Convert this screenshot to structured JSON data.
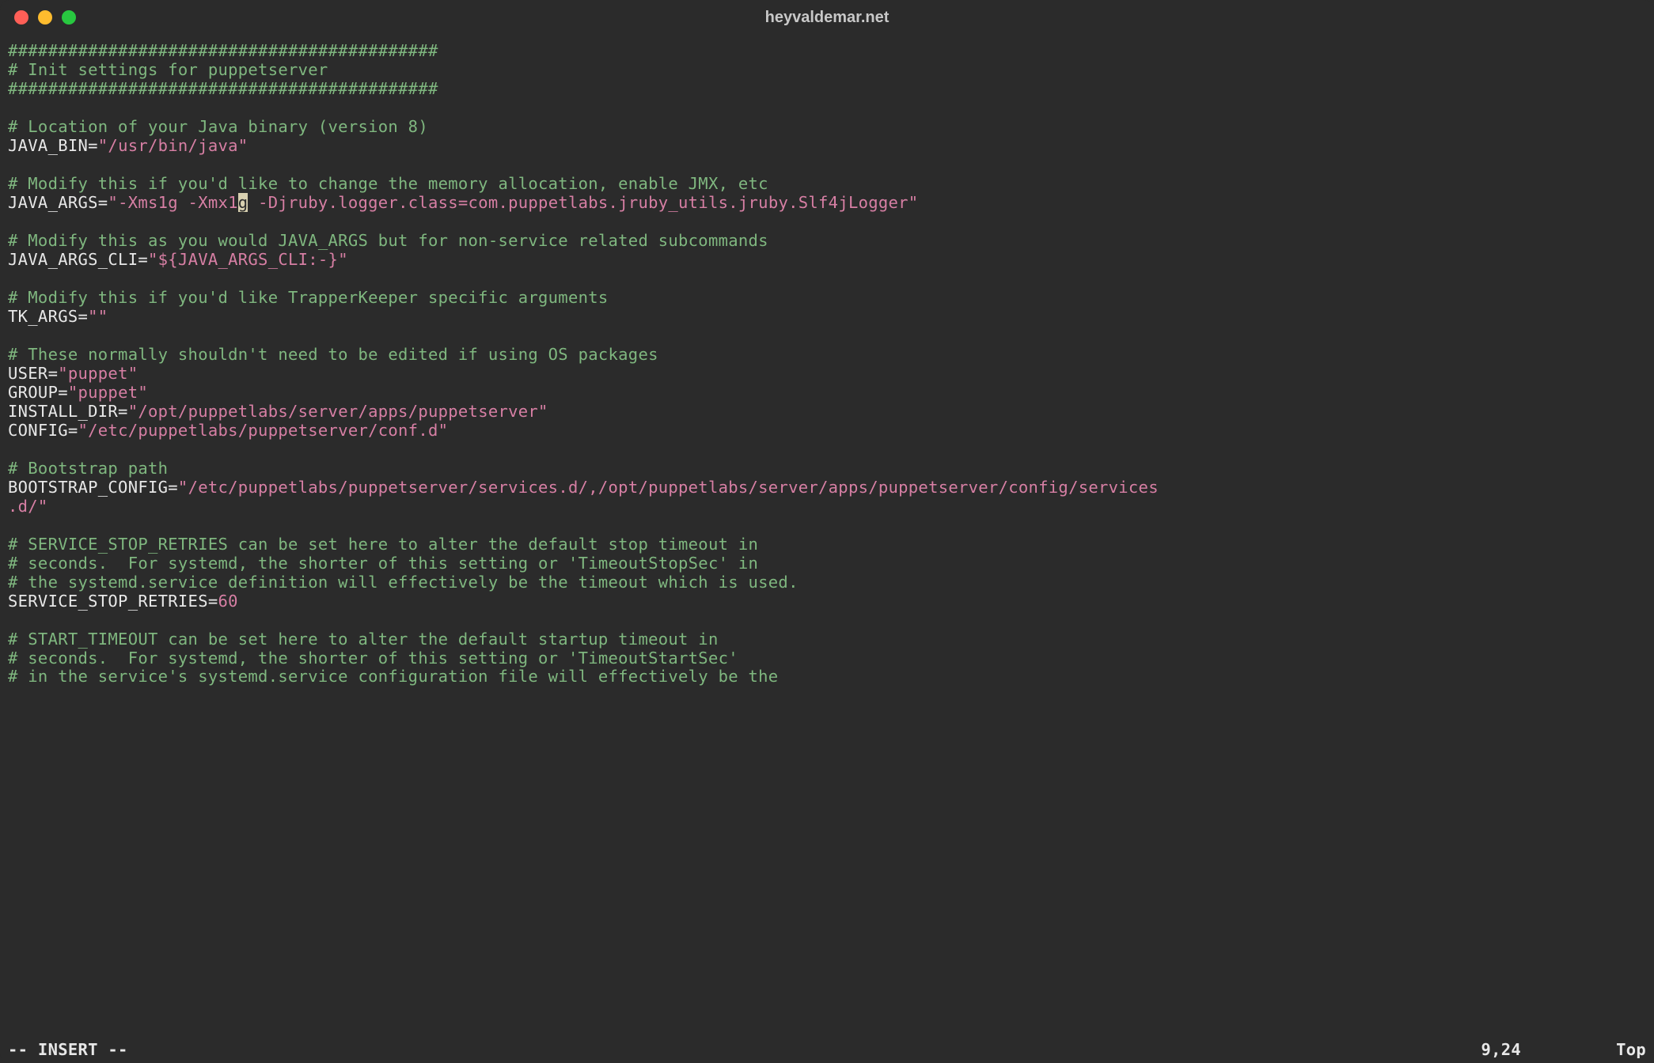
{
  "window": {
    "title": "heyvaldemar.net"
  },
  "editor": {
    "cursor_line": 9,
    "cursor_col": 24,
    "lines": {
      "l1": "###########################################",
      "l2": "# Init settings for puppetserver",
      "l3": "###########################################",
      "l5": "# Location of your Java binary (version 8)",
      "l6_key": "JAVA_BIN=",
      "l6_val": "\"/usr/bin/java\"",
      "l8": "# Modify this if you'd like to change the memory allocation, enable JMX, etc",
      "l9_key": "JAVA_ARGS=",
      "l9_val_a": "\"-Xms1g -Xmx1",
      "l9_cursor": "g",
      "l9_val_b": " -Djruby.logger.class=com.puppetlabs.jruby_utils.jruby.Slf4jLogger\"",
      "l11": "# Modify this as you would JAVA_ARGS but for non-service related subcommands",
      "l12_key": "JAVA_ARGS_CLI=",
      "l12_val": "\"${JAVA_ARGS_CLI:-}\"",
      "l14": "# Modify this if you'd like TrapperKeeper specific arguments",
      "l15_key": "TK_ARGS=",
      "l15_val": "\"\"",
      "l17": "# These normally shouldn't need to be edited if using OS packages",
      "l18_key": "USER=",
      "l18_val": "\"puppet\"",
      "l19_key": "GROUP=",
      "l19_val": "\"puppet\"",
      "l20_key": "INSTALL_DIR=",
      "l20_val": "\"/opt/puppetlabs/server/apps/puppetserver\"",
      "l21_key": "CONFIG=",
      "l21_val": "\"/etc/puppetlabs/puppetserver/conf.d\"",
      "l23": "# Bootstrap path",
      "l24_key": "BOOTSTRAP_CONFIG=",
      "l24_val": "\"/etc/puppetlabs/puppetserver/services.d/,/opt/puppetlabs/server/apps/puppetserver/config/services",
      "l25_val": ".d/\"",
      "l27": "# SERVICE_STOP_RETRIES can be set here to alter the default stop timeout in",
      "l28": "# seconds.  For systemd, the shorter of this setting or 'TimeoutStopSec' in",
      "l29": "# the systemd.service definition will effectively be the timeout which is used.",
      "l30_key": "SERVICE_STOP_RETRIES=",
      "l30_val": "60",
      "l32": "# START_TIMEOUT can be set here to alter the default startup timeout in",
      "l33": "# seconds.  For systemd, the shorter of this setting or 'TimeoutStartSec'",
      "l34": "# in the service's systemd.service configuration file will effectively be the"
    }
  },
  "status": {
    "mode": "-- INSERT --",
    "position": "9,24",
    "scroll": "Top"
  }
}
